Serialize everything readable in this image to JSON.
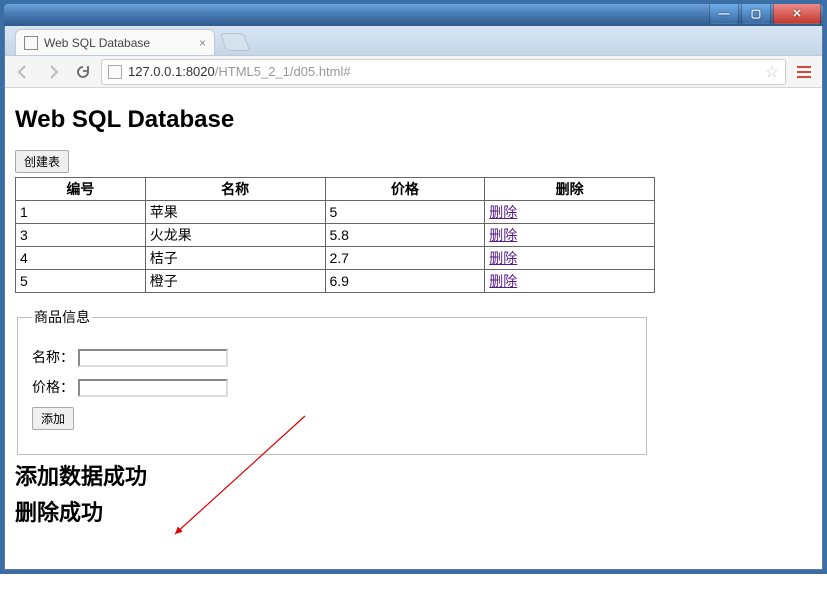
{
  "window": {
    "min": "—",
    "max": "▢",
    "close": "✕"
  },
  "browser": {
    "tab_title": "Web SQL Database",
    "url_host": "127.0.0.1:8020",
    "url_path": "/HTML5_2_1/d05.html#"
  },
  "page": {
    "heading": "Web SQL Database",
    "create_table_btn": "创建表",
    "columns": {
      "id": "编号",
      "name": "名称",
      "price": "价格",
      "delete": "删除"
    },
    "rows": [
      {
        "id": "1",
        "name": "苹果",
        "price": "5",
        "delete": "删除"
      },
      {
        "id": "3",
        "name": "火龙果",
        "price": "5.8",
        "delete": "删除"
      },
      {
        "id": "4",
        "name": "桔子",
        "price": "2.7",
        "delete": "删除"
      },
      {
        "id": "5",
        "name": "橙子",
        "price": "6.9",
        "delete": "删除"
      }
    ],
    "form": {
      "legend": "商品信息",
      "name_label": "名称：",
      "price_label": "价格：",
      "name_value": "",
      "price_value": "",
      "add_btn": "添加"
    },
    "messages": {
      "add_ok": "添加数据成功",
      "del_ok": "删除成功"
    }
  }
}
